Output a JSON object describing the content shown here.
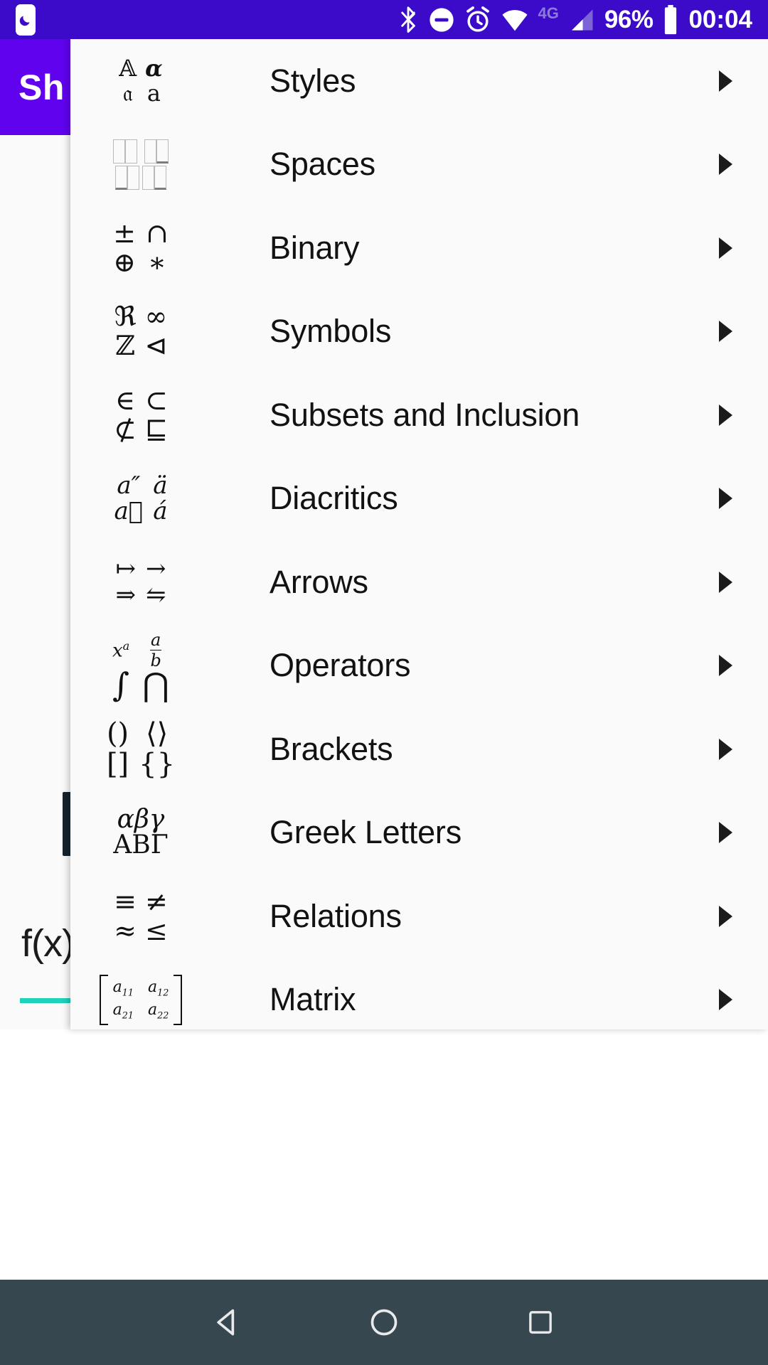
{
  "status_bar": {
    "background_color": "#3B0BC9",
    "left_icon": "moon-icon",
    "icons": [
      "bluetooth-icon",
      "do-not-disturb-icon",
      "alarm-icon",
      "wifi-icon"
    ],
    "network_type": "4G",
    "battery_percent": "96%",
    "clock": "00:04"
  },
  "app_bar": {
    "title": "Sh",
    "background_color": "#6002EE"
  },
  "app_behind": {
    "fx_label": "f(x)",
    "accent_color": "#1DD3B8"
  },
  "menu": {
    "background_color": "#FAFAFA",
    "items": [
      {
        "label": "Styles",
        "icon": "styles-icon",
        "glyphs": [
          "𝔸",
          "α",
          "𝔞",
          "a"
        ]
      },
      {
        "label": "Spaces",
        "icon": "spaces-icon",
        "glyphs": []
      },
      {
        "label": "Binary",
        "icon": "binary-icon",
        "glyphs": [
          "±",
          "∩",
          "⊕",
          "∗"
        ]
      },
      {
        "label": "Symbols",
        "icon": "symbols-icon",
        "glyphs": [
          "ℜ",
          "∞",
          "ℤ",
          "⊲"
        ]
      },
      {
        "label": "Subsets and Inclusion",
        "icon": "subsets-icon",
        "glyphs": [
          "∈",
          "⊂",
          "⊄",
          "⊑"
        ]
      },
      {
        "label": "Diacritics",
        "icon": "diacritics-icon",
        "glyphs": [
          "a″",
          "ä",
          "a⃗",
          "á"
        ]
      },
      {
        "label": "Arrows",
        "icon": "arrows-icon",
        "glyphs": [
          "↦",
          "→",
          "⇒",
          "⇋"
        ]
      },
      {
        "label": "Operators",
        "icon": "operators-icon",
        "glyphs": [
          "xᵃ",
          "a/b",
          "∫",
          "⋂"
        ]
      },
      {
        "label": "Brackets",
        "icon": "brackets-icon",
        "glyphs": [
          "()",
          "⟨⟩",
          "[]",
          "{}"
        ]
      },
      {
        "label": "Greek Letters",
        "icon": "greek-icon",
        "glyphs": [
          "αβγ",
          "ΑΒΓ"
        ]
      },
      {
        "label": "Relations",
        "icon": "relations-icon",
        "glyphs": [
          "≡",
          "≠",
          "≈",
          "≤"
        ]
      },
      {
        "label": "Matrix",
        "icon": "matrix-icon",
        "glyphs": [
          "a11",
          "a12",
          "a21",
          "a22"
        ]
      }
    ],
    "chevron": "chevron-right-icon"
  },
  "nav_bar": {
    "background_color": "#37474F",
    "buttons": [
      "back-button",
      "home-button",
      "recents-button"
    ]
  },
  "icon_glyphs": {
    "styles": {
      "a": "𝔸",
      "b": "α",
      "c": "𝔞",
      "d": "a"
    },
    "binary": {
      "a": "±",
      "b": "∩",
      "c": "⊕",
      "d": "∗"
    },
    "symbols": {
      "a": "ℜ",
      "b": "∞",
      "c": "ℤ",
      "d": "⊲"
    },
    "subsets": {
      "a": "∈",
      "b": "⊂",
      "c": "⊄",
      "d": "⊑"
    },
    "diacritics": {
      "a": "a″",
      "b": "ä",
      "c": "a⃗",
      "d": "á"
    },
    "arrows": {
      "a": "↦",
      "b": "→",
      "c": "⇒",
      "d": "⇋"
    },
    "operators": {
      "a": "x",
      "a_sup": "a",
      "b_num": "a",
      "b_den": "b",
      "c": "∫",
      "d": "⋂"
    },
    "brackets": {
      "a": "()",
      "b": "⟨⟩",
      "c": "[]",
      "d": "{}"
    },
    "greek": {
      "a": "αβγ",
      "b": "ΑΒΓ"
    },
    "relations": {
      "a": "≡",
      "b": "≠",
      "c": "≈",
      "d": "≤"
    },
    "matrix": {
      "a": "a",
      "a_sub": "11",
      "b": "a",
      "b_sub": "12",
      "c": "a",
      "c_sub": "21",
      "d": "a",
      "d_sub": "22"
    }
  }
}
